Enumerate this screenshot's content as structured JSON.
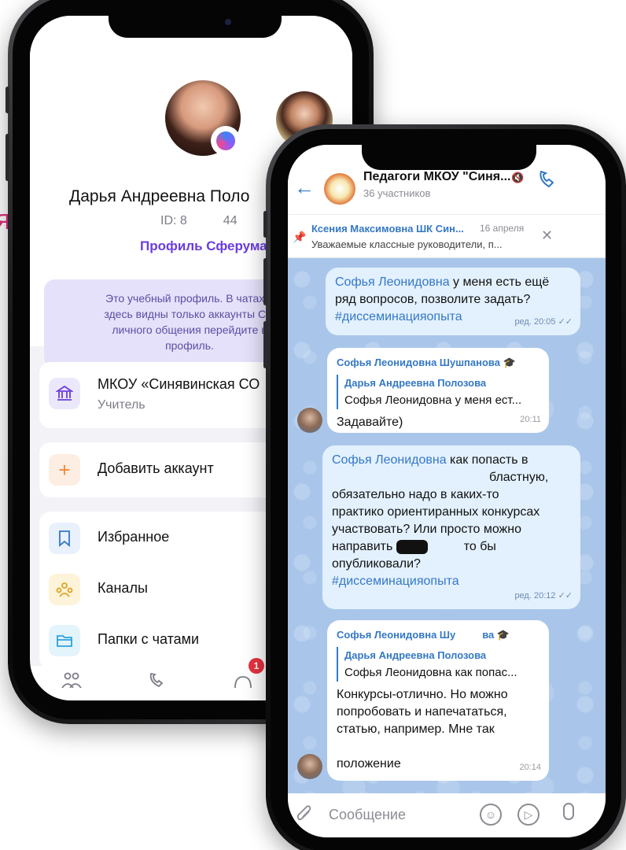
{
  "decor": {
    "pink_fragment": "я"
  },
  "profile": {
    "name": "Дарья Андреевна Поло",
    "id_prefix": "ID: 8",
    "id_suffix": "44",
    "profile_link": "Профиль Сферума",
    "notice": "Это учебный профиль. В чатах и здесь видны только аккаунты Сф личного общения перейдите в профиль.",
    "notice_lines": [
      "Это учебный профиль. В чатах и",
      "здесь видны только аккаунты Сф",
      "личного общения перейдите в",
      "профиль."
    ],
    "org_name": "МКОУ «Синявинская СО",
    "org_role": "Учитель",
    "add_account": "Добавить аккаунт",
    "favorites": "Избранное",
    "channels": "Каналы",
    "folders": "Папки с чатами",
    "tab_badge": "1"
  },
  "chat": {
    "title": "Педагоги МКОУ \"Синя...",
    "members": "36 участников",
    "pinned": {
      "author": "Ксения Максимовна ШК Син...",
      "date": "16 апреля",
      "text": "Уважаемые классные руководители, п..."
    },
    "messages": [
      {
        "mention": "Софья Леонидовна",
        "text": " у меня есть ещё ряд вопросов, позволите задать?",
        "hashtag": "#диссеминацияопыта",
        "time": "ред. 20:05"
      },
      {
        "sender": "Софья Леонидовна Шушпанова",
        "reply_name": "Дарья Андреевна Полозова",
        "reply_text": "Софья Леонидовна у меня ест...",
        "text": "Задавайте)",
        "time": "20:11"
      },
      {
        "mention": "Софья Леонидовна",
        "line1": " как попасть в",
        "line2": "бластную,",
        "line3": "обязательно надо в каких-то",
        "line4": "практико ориентиранных конкурсах",
        "line5": "участвовать? Или просто можно",
        "line6a": "направить",
        "line6b": "то бы",
        "line7": "опубликовали?",
        "hashtag": "#диссеминацияопыта",
        "time": "ред. 20:12"
      },
      {
        "sender": "Софья Леонидовна Шу",
        "sender_tail": "ва",
        "reply_name": "Дарья Андреевна Полозова",
        "reply_text": "Софья Леонидовна как попас...",
        "line1": "Конкурсы-отлично. Но можно",
        "line2": "попробовать и напечататься,",
        "line3": "статью, например. Мне так",
        "line4": "положение",
        "time": "20:14"
      }
    ],
    "composer_placeholder": "Сообщение"
  },
  "colors": {
    "accent_blue": "#3478c6",
    "sferum_purple": "#6a3de0",
    "chat_bg": "#a9c6ea",
    "outgoing_bubble": "#e3f1ff",
    "badge_red": "#e8323f"
  }
}
